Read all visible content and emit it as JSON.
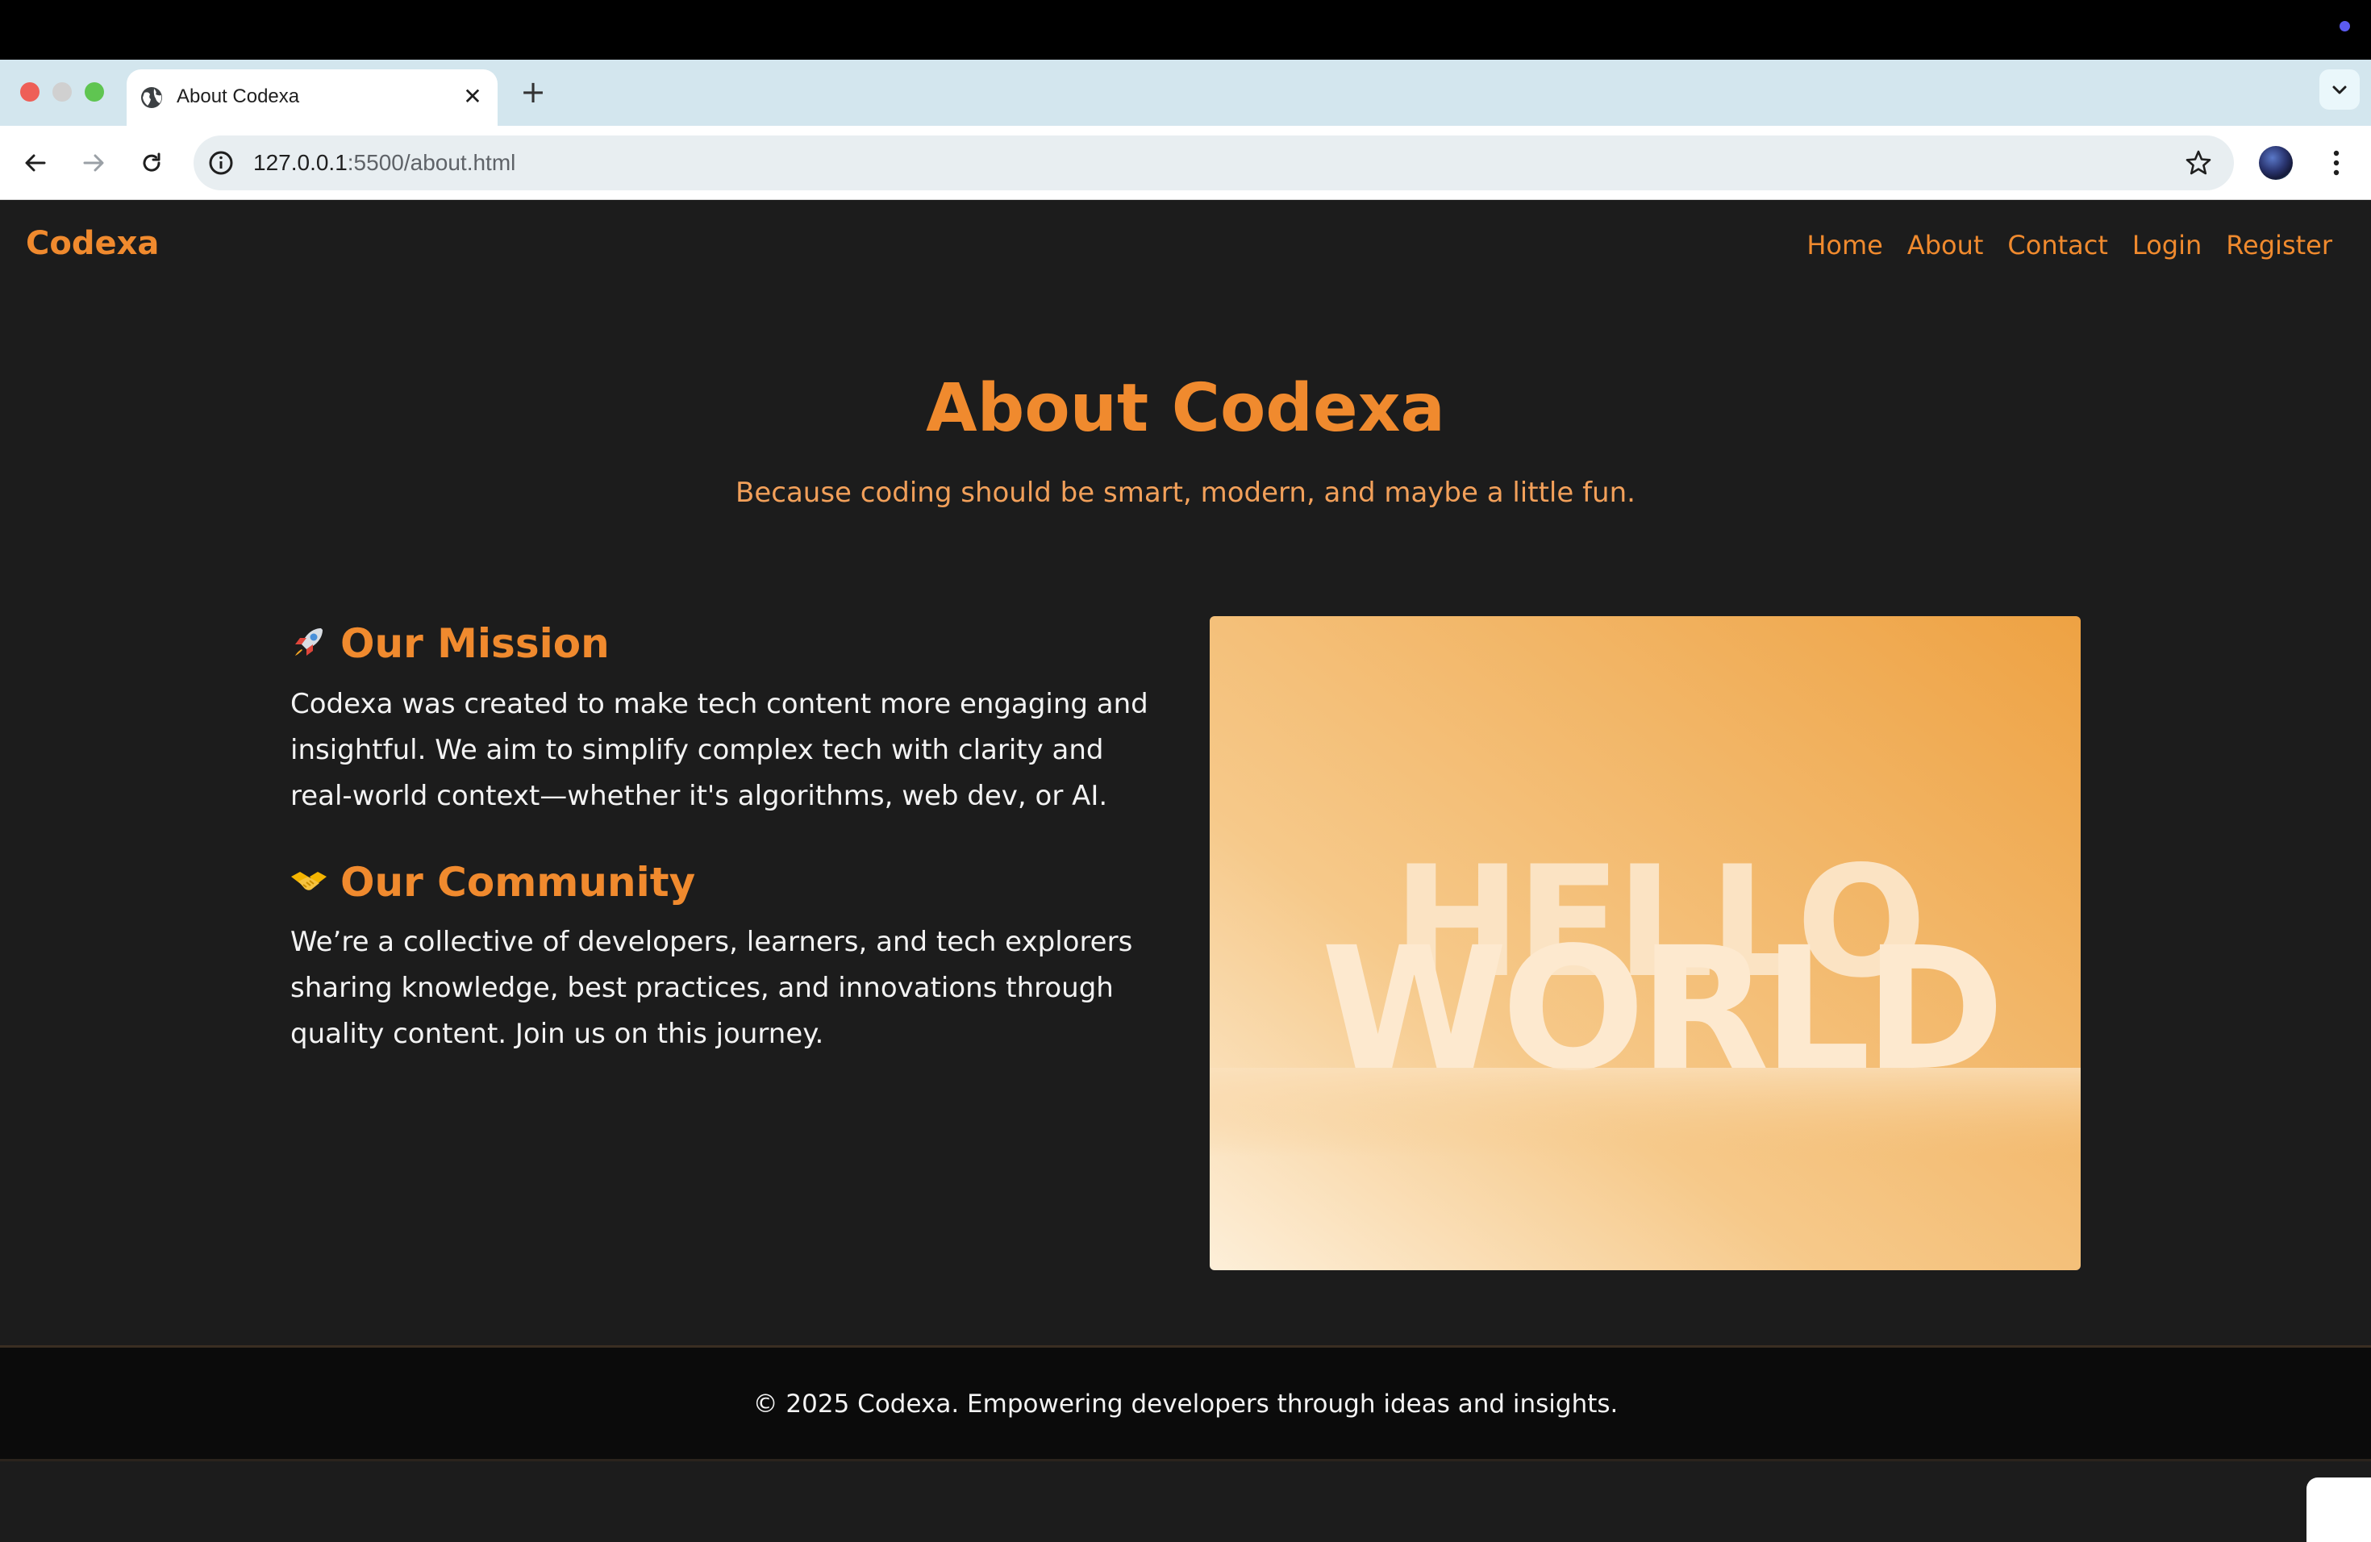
{
  "browser": {
    "tab_title": "About Codexa",
    "tab_close": "✕",
    "new_tab": "+",
    "url_host": "127.0.0.1",
    "url_path": ":5500/about.html"
  },
  "site": {
    "brand": "Codexa",
    "nav": [
      "Home",
      "About",
      "Contact",
      "Login",
      "Register"
    ]
  },
  "hero": {
    "title": "About Codexa",
    "subtitle": "Because coding should be smart, modern, and maybe a little fun."
  },
  "mission": {
    "icon": "rocket-icon",
    "heading": "Our Mission",
    "body": "Codexa was created to make tech content more engaging and insightful. We aim to simplify complex tech with clarity and real-world context—whether it's algorithms, web dev, or AI."
  },
  "community": {
    "icon": "handshake-icon",
    "heading": "Our Community",
    "body": "We’re a collective of developers, learners, and tech explorers sharing knowledge, best practices, and innovations through quality content. Join us on this journey."
  },
  "image": {
    "line1": "HELLO",
    "line2": "WORLD"
  },
  "footer": {
    "text": "© 2025 Codexa. Empowering developers through ideas and insights."
  },
  "colors": {
    "accent": "#f08a2e",
    "page_bg": "#1c1c1c",
    "footer_bg": "#0b0b0b"
  }
}
